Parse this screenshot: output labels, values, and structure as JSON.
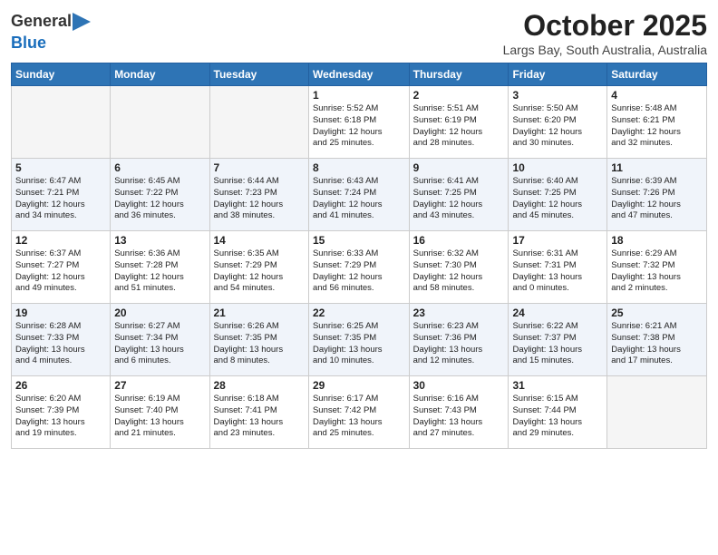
{
  "logo": {
    "general": "General",
    "blue": "Blue"
  },
  "header": {
    "month": "October 2025",
    "location": "Largs Bay, South Australia, Australia"
  },
  "weekdays": [
    "Sunday",
    "Monday",
    "Tuesday",
    "Wednesday",
    "Thursday",
    "Friday",
    "Saturday"
  ],
  "weeks": [
    [
      {
        "day": "",
        "info": ""
      },
      {
        "day": "",
        "info": ""
      },
      {
        "day": "",
        "info": ""
      },
      {
        "day": "1",
        "info": "Sunrise: 5:52 AM\nSunset: 6:18 PM\nDaylight: 12 hours\nand 25 minutes."
      },
      {
        "day": "2",
        "info": "Sunrise: 5:51 AM\nSunset: 6:19 PM\nDaylight: 12 hours\nand 28 minutes."
      },
      {
        "day": "3",
        "info": "Sunrise: 5:50 AM\nSunset: 6:20 PM\nDaylight: 12 hours\nand 30 minutes."
      },
      {
        "day": "4",
        "info": "Sunrise: 5:48 AM\nSunset: 6:21 PM\nDaylight: 12 hours\nand 32 minutes."
      }
    ],
    [
      {
        "day": "5",
        "info": "Sunrise: 6:47 AM\nSunset: 7:21 PM\nDaylight: 12 hours\nand 34 minutes."
      },
      {
        "day": "6",
        "info": "Sunrise: 6:45 AM\nSunset: 7:22 PM\nDaylight: 12 hours\nand 36 minutes."
      },
      {
        "day": "7",
        "info": "Sunrise: 6:44 AM\nSunset: 7:23 PM\nDaylight: 12 hours\nand 38 minutes."
      },
      {
        "day": "8",
        "info": "Sunrise: 6:43 AM\nSunset: 7:24 PM\nDaylight: 12 hours\nand 41 minutes."
      },
      {
        "day": "9",
        "info": "Sunrise: 6:41 AM\nSunset: 7:25 PM\nDaylight: 12 hours\nand 43 minutes."
      },
      {
        "day": "10",
        "info": "Sunrise: 6:40 AM\nSunset: 7:25 PM\nDaylight: 12 hours\nand 45 minutes."
      },
      {
        "day": "11",
        "info": "Sunrise: 6:39 AM\nSunset: 7:26 PM\nDaylight: 12 hours\nand 47 minutes."
      }
    ],
    [
      {
        "day": "12",
        "info": "Sunrise: 6:37 AM\nSunset: 7:27 PM\nDaylight: 12 hours\nand 49 minutes."
      },
      {
        "day": "13",
        "info": "Sunrise: 6:36 AM\nSunset: 7:28 PM\nDaylight: 12 hours\nand 51 minutes."
      },
      {
        "day": "14",
        "info": "Sunrise: 6:35 AM\nSunset: 7:29 PM\nDaylight: 12 hours\nand 54 minutes."
      },
      {
        "day": "15",
        "info": "Sunrise: 6:33 AM\nSunset: 7:29 PM\nDaylight: 12 hours\nand 56 minutes."
      },
      {
        "day": "16",
        "info": "Sunrise: 6:32 AM\nSunset: 7:30 PM\nDaylight: 12 hours\nand 58 minutes."
      },
      {
        "day": "17",
        "info": "Sunrise: 6:31 AM\nSunset: 7:31 PM\nDaylight: 13 hours\nand 0 minutes."
      },
      {
        "day": "18",
        "info": "Sunrise: 6:29 AM\nSunset: 7:32 PM\nDaylight: 13 hours\nand 2 minutes."
      }
    ],
    [
      {
        "day": "19",
        "info": "Sunrise: 6:28 AM\nSunset: 7:33 PM\nDaylight: 13 hours\nand 4 minutes."
      },
      {
        "day": "20",
        "info": "Sunrise: 6:27 AM\nSunset: 7:34 PM\nDaylight: 13 hours\nand 6 minutes."
      },
      {
        "day": "21",
        "info": "Sunrise: 6:26 AM\nSunset: 7:35 PM\nDaylight: 13 hours\nand 8 minutes."
      },
      {
        "day": "22",
        "info": "Sunrise: 6:25 AM\nSunset: 7:35 PM\nDaylight: 13 hours\nand 10 minutes."
      },
      {
        "day": "23",
        "info": "Sunrise: 6:23 AM\nSunset: 7:36 PM\nDaylight: 13 hours\nand 12 minutes."
      },
      {
        "day": "24",
        "info": "Sunrise: 6:22 AM\nSunset: 7:37 PM\nDaylight: 13 hours\nand 15 minutes."
      },
      {
        "day": "25",
        "info": "Sunrise: 6:21 AM\nSunset: 7:38 PM\nDaylight: 13 hours\nand 17 minutes."
      }
    ],
    [
      {
        "day": "26",
        "info": "Sunrise: 6:20 AM\nSunset: 7:39 PM\nDaylight: 13 hours\nand 19 minutes."
      },
      {
        "day": "27",
        "info": "Sunrise: 6:19 AM\nSunset: 7:40 PM\nDaylight: 13 hours\nand 21 minutes."
      },
      {
        "day": "28",
        "info": "Sunrise: 6:18 AM\nSunset: 7:41 PM\nDaylight: 13 hours\nand 23 minutes."
      },
      {
        "day": "29",
        "info": "Sunrise: 6:17 AM\nSunset: 7:42 PM\nDaylight: 13 hours\nand 25 minutes."
      },
      {
        "day": "30",
        "info": "Sunrise: 6:16 AM\nSunset: 7:43 PM\nDaylight: 13 hours\nand 27 minutes."
      },
      {
        "day": "31",
        "info": "Sunrise: 6:15 AM\nSunset: 7:44 PM\nDaylight: 13 hours\nand 29 minutes."
      },
      {
        "day": "",
        "info": ""
      }
    ]
  ]
}
